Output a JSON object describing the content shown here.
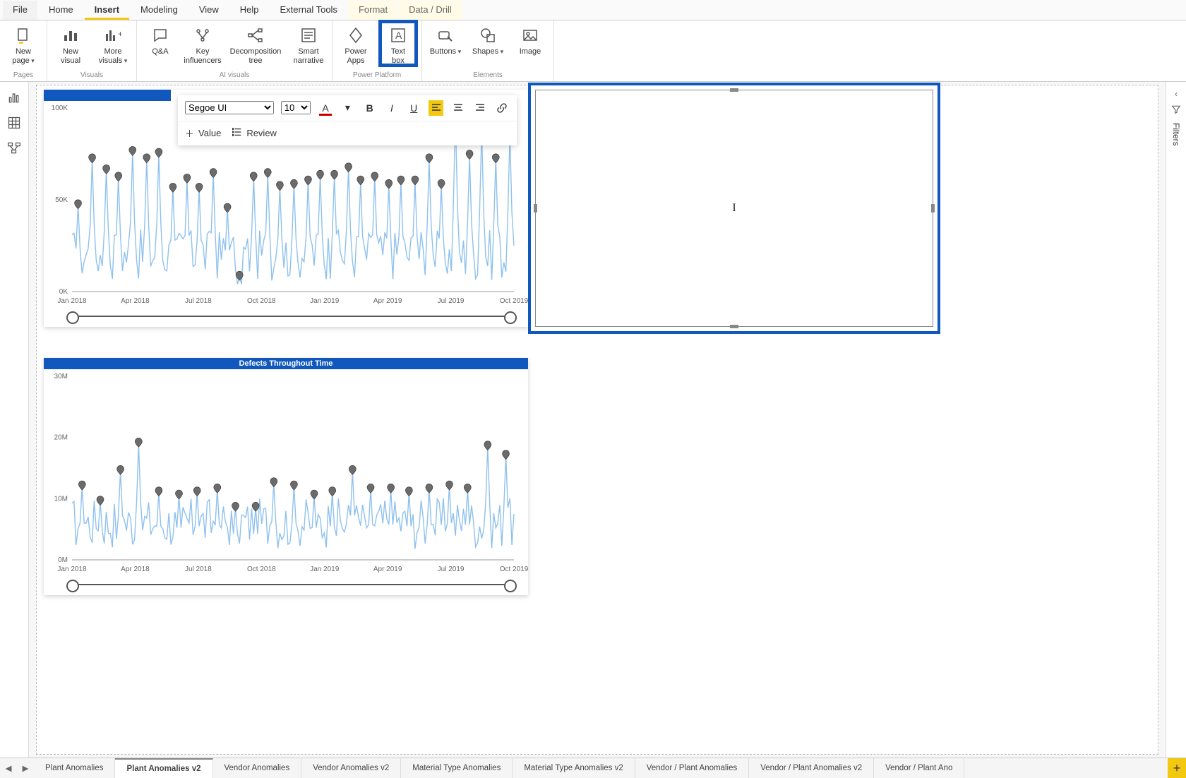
{
  "ribbon": {
    "tabs": {
      "file": "File",
      "home": "Home",
      "insert": "Insert",
      "modeling": "Modeling",
      "view": "View",
      "help": "Help",
      "external_tools": "External Tools",
      "format": "Format",
      "data_drill": "Data / Drill"
    },
    "groups": {
      "pages": "Pages",
      "visuals": "Visuals",
      "ai_visuals": "AI visuals",
      "power_platform": "Power Platform",
      "elements": "Elements"
    },
    "buttons": {
      "new_page": "New\npage",
      "new_visual": "New\nvisual",
      "more_visuals": "More\nvisuals",
      "qa": "Q&A",
      "key_influencers": "Key\ninfluencers",
      "decomposition_tree": "Decomposition\ntree",
      "smart_narrative": "Smart\nnarrative",
      "power_apps": "Power Apps",
      "text_box": "Text\nbox",
      "buttons": "Buttons",
      "shapes": "Shapes",
      "image": "Image"
    }
  },
  "filters_label": "Filters",
  "format_toolbar": {
    "font_family": "Segoe UI",
    "font_size": "10",
    "value_label": "Value",
    "review_label": "Review"
  },
  "chart1": {
    "title": "",
    "x_labels": [
      "Jan 2018",
      "Apr 2018",
      "Jul 2018",
      "Oct 2018",
      "Jan 2019",
      "Apr 2019",
      "Jul 2019",
      "Oct 2019"
    ],
    "y_labels": [
      "0K",
      "50K",
      "100K"
    ]
  },
  "chart2": {
    "title": "Defects Throughout Time",
    "x_labels": [
      "Jan 2018",
      "Apr 2018",
      "Jul 2018",
      "Oct 2018",
      "Jan 2019",
      "Apr 2019",
      "Jul 2019",
      "Oct 2019"
    ],
    "y_labels": [
      "0M",
      "10M",
      "20M",
      "30M"
    ]
  },
  "page_tabs": [
    "Plant Anomalies",
    "Plant Anomalies v2",
    "Vendor Anomalies",
    "Vendor Anomalies v2",
    "Material Type Anomalies",
    "Material Type Anomalies v2",
    "Vendor / Plant Anomalies",
    "Vendor / Plant Anomalies v2",
    "Vendor / Plant Ano"
  ],
  "active_page_tab_index": 1,
  "chart_data": [
    {
      "type": "line",
      "title": "",
      "xlabel": "",
      "ylabel": "",
      "ylim": [
        0,
        100000
      ],
      "x": [
        "Jan 2018",
        "Apr 2018",
        "Jul 2018",
        "Oct 2018",
        "Jan 2019",
        "Apr 2019",
        "Jul 2019",
        "Oct 2019"
      ],
      "anomalies_approx": [
        47000,
        72000,
        66000,
        62000,
        76000,
        72000,
        75000,
        56000,
        61000,
        56000,
        64000,
        45000,
        8000,
        62000,
        64000,
        57000,
        58000,
        60000,
        63000,
        63000,
        67000,
        60000,
        62000,
        58000,
        60000,
        60000,
        72000,
        58000,
        95000,
        74000,
        88000,
        72000,
        86000
      ],
      "note": "Dense sub-monthly line with ~33 anomaly markers; values approximate from y-axis"
    },
    {
      "type": "line",
      "title": "Defects Throughout Time",
      "xlabel": "",
      "ylabel": "",
      "ylim": [
        0,
        30000000
      ],
      "x": [
        "Jan 2018",
        "Apr 2018",
        "Jul 2018",
        "Oct 2018",
        "Jan 2019",
        "Apr 2019",
        "Jul 2019",
        "Oct 2019"
      ],
      "anomalies_approx": [
        12000000,
        9500000,
        14500000,
        19000000,
        11000000,
        10500000,
        11000000,
        11500000,
        8500000,
        8500000,
        12500000,
        12000000,
        10500000,
        11000000,
        14500000,
        11500000,
        11500000,
        11000000,
        11500000,
        12000000,
        11500000,
        18500000,
        17000000
      ],
      "note": "Dense sub-monthly line with ~23 anomaly markers; values approximate from y-axis"
    }
  ]
}
